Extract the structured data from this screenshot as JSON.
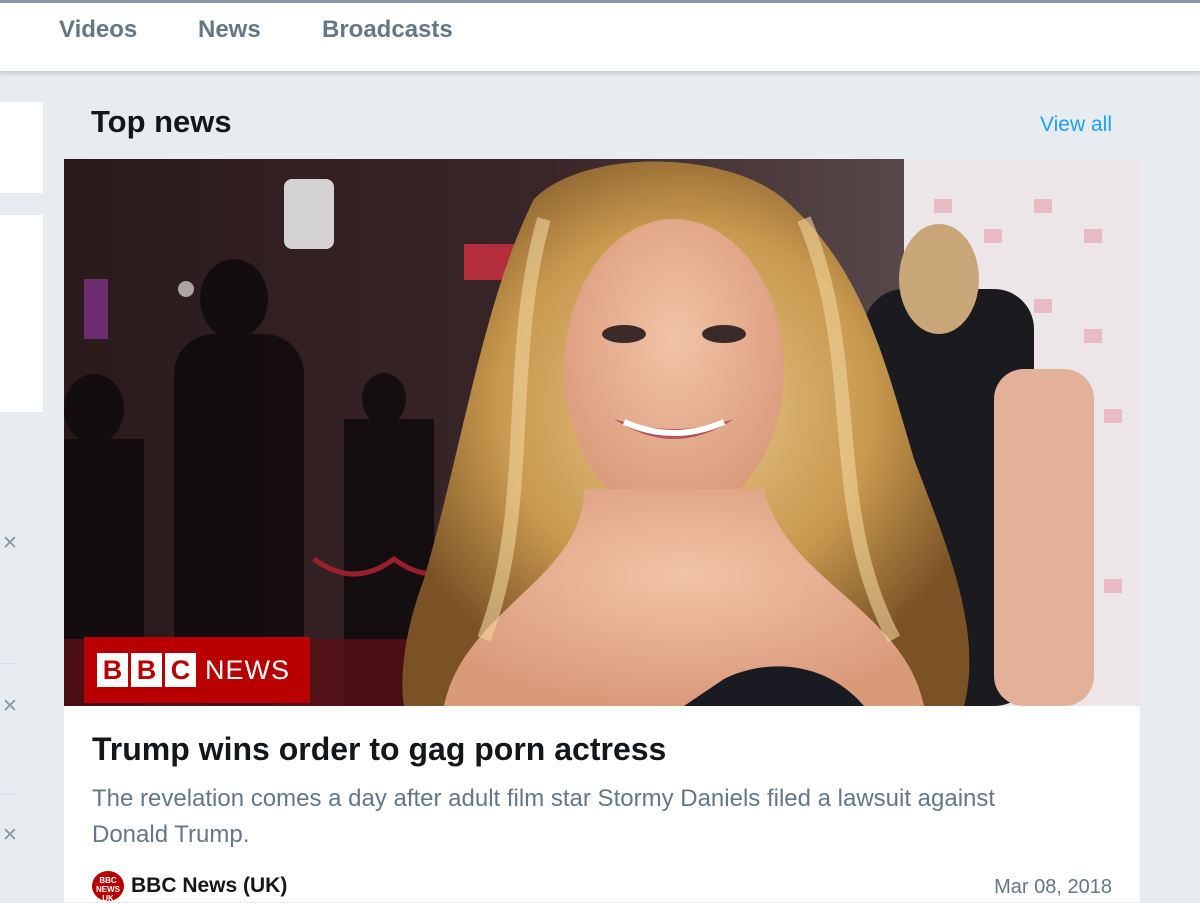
{
  "nav": {
    "tabs": [
      {
        "label": "Videos"
      },
      {
        "label": "News"
      },
      {
        "label": "Broadcasts"
      }
    ]
  },
  "section": {
    "title": "Top news",
    "view_all_label": "View all"
  },
  "article": {
    "image_badge_letters": [
      "B",
      "B",
      "C"
    ],
    "image_badge_word": "NEWS",
    "headline": "Trump wins order to gag porn actress",
    "summary": "The revelation comes a day after adult film star Stormy Daniels filed a lawsuit against Donald Trump.",
    "source_logo_text": [
      "BBC",
      "NEWS",
      "UK"
    ],
    "source_name": "BBC News (UK)",
    "date": "Mar 08, 2018"
  },
  "icons": {
    "dismiss": "close-icon",
    "source": "bbc-news-logo"
  },
  "colors": {
    "accent": "#1da1f2",
    "bbc_red": "#b80000",
    "text_primary": "#14171a",
    "text_secondary": "#657786",
    "background": "#e6ecf0"
  }
}
